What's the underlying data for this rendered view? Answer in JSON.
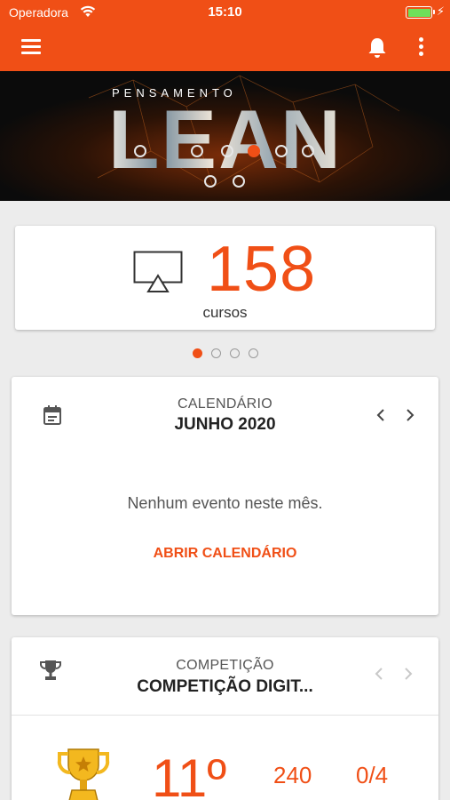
{
  "status_bar": {
    "carrier": "Operadora",
    "time": "15:10"
  },
  "app_bar": {
    "menu_icon": "hamburger-menu-icon",
    "notifications_icon": "bell-icon",
    "more_icon": "more-vertical-icon"
  },
  "banner": {
    "subtitle": "PENSAMENTO",
    "title": "LEAN"
  },
  "courses_card": {
    "count": "158",
    "label": "cursos",
    "icon": "tv-cast-icon"
  },
  "pager": {
    "total": 4,
    "active_index": 0
  },
  "calendar_card": {
    "kicker": "CALENDÁRIO",
    "month": "JUNHO 2020",
    "empty_message": "Nenhum evento neste mês.",
    "action_label": "ABRIR CALENDÁRIO"
  },
  "competition_card": {
    "kicker": "COMPETIÇÃO",
    "title": "COMPETIÇÃO DIGIT...",
    "rank": "11º",
    "points": "240",
    "progress": "0/4"
  },
  "colors": {
    "accent": "#f04f16",
    "background": "#ececec"
  }
}
